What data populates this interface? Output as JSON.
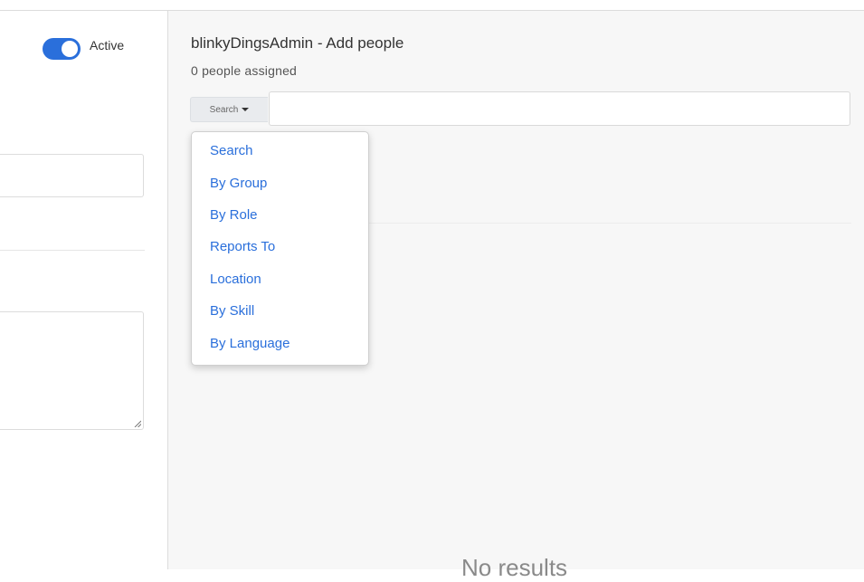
{
  "left": {
    "toggle_label": "Active",
    "toggle_on": true,
    "accent_color": "#2a6fdb"
  },
  "panel": {
    "title": "blinkyDingsAdmin - Add people",
    "subtitle": "0 people assigned",
    "search_toggle_label": "Search",
    "search_value": "",
    "dropdown_items": [
      "Search",
      "By Group",
      "By Role",
      "Reports To",
      "Location",
      "By Skill",
      "By Language"
    ],
    "no_results": "No results"
  }
}
